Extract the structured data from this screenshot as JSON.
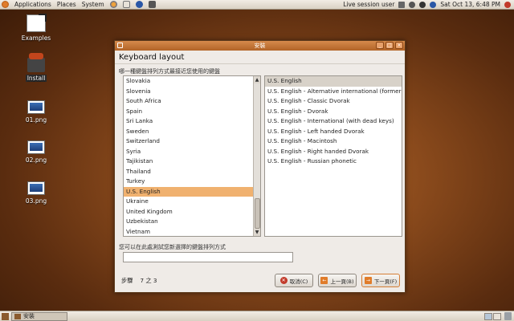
{
  "top_panel": {
    "menus": [
      "Applications",
      "Places",
      "System"
    ],
    "session": "Live session user",
    "datetime": "Sat Oct 13,  6:48 PM"
  },
  "desktop_icons": [
    {
      "label": "Examples"
    },
    {
      "label": "Install"
    },
    {
      "label": "01.png"
    },
    {
      "label": "02.png"
    },
    {
      "label": "03.png"
    }
  ],
  "window": {
    "title": "安裝",
    "heading": "Keyboard layout",
    "instruction": "哪一種鍵盤排列方式最接近您使用的鍵盤",
    "layouts": [
      "Slovakia",
      "Slovenia",
      "South Africa",
      "Spain",
      "Sri Lanka",
      "Sweden",
      "Switzerland",
      "Syria",
      "Tajikistan",
      "Thailand",
      "Turkey",
      "U.S. English",
      "Ukraine",
      "United Kingdom",
      "Uzbekistan",
      "Vietnam"
    ],
    "selected_layout": "U.S. English",
    "variants": [
      "U.S. English",
      "U.S. English - Alternative international (former us_int",
      "U.S. English - Classic Dvorak",
      "U.S. English - Dvorak",
      "U.S. English - International (with dead keys)",
      "U.S. English - Left handed Dvorak",
      "U.S. English - Macintosh",
      "U.S. English - Right handed Dvorak",
      "U.S. English - Russian phonetic"
    ],
    "selected_variant": "U.S. English",
    "test_label": "您可以在此處測試您新選擇的鍵盤排列方式",
    "test_value": "",
    "step_label": "步驟",
    "step_current": "7",
    "step_sep": "之",
    "step_total": "3",
    "cancel_label": "取消(C)",
    "back_label": "上一頁(B)",
    "next_label": "下一頁(F)"
  },
  "bottom_panel": {
    "task_label": "安裝"
  },
  "colors": {
    "accent": "#f0b16f",
    "titlebar": "#c0743a"
  }
}
